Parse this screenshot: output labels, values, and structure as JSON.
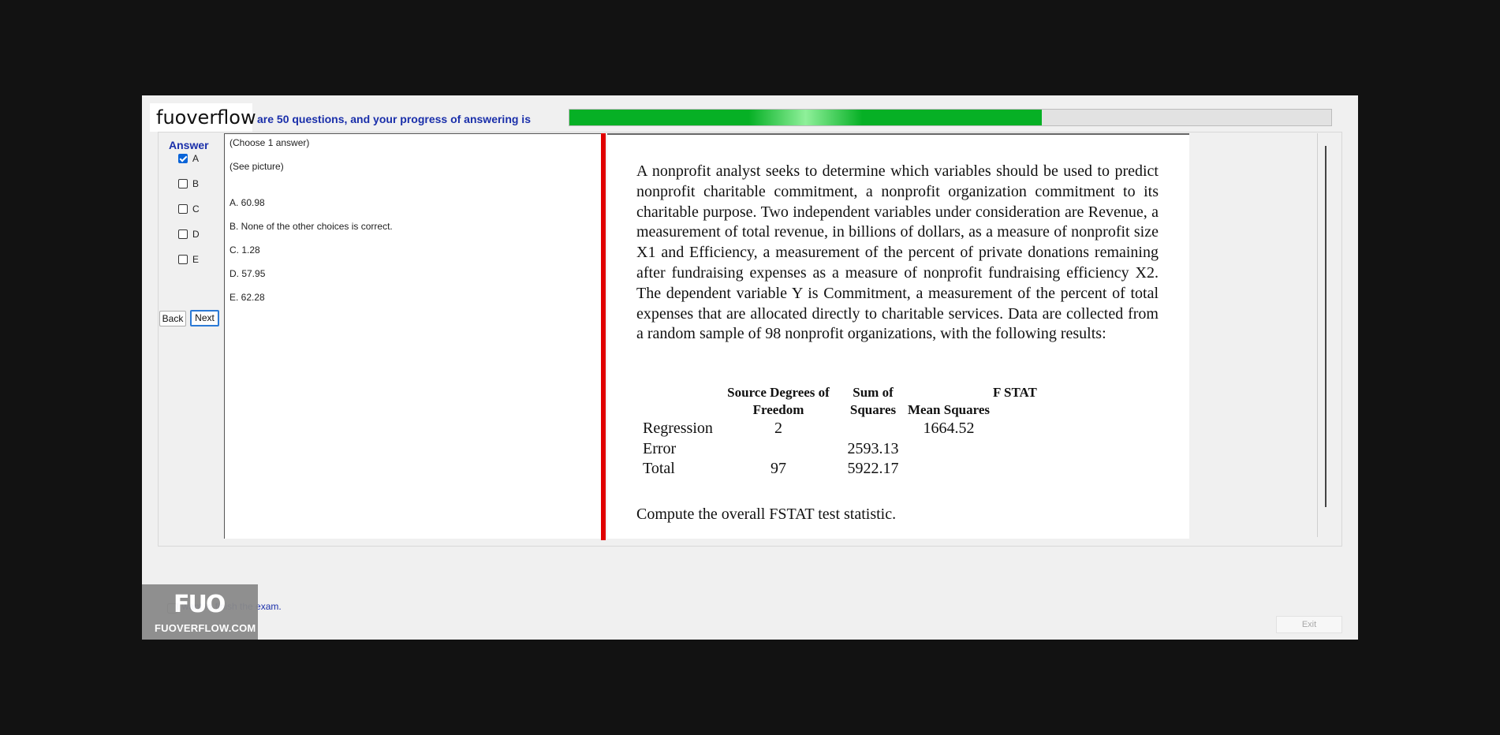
{
  "brand": "fuoverflow",
  "progress": {
    "label": "are 50 questions, and your progress of answering is",
    "value": 0.62,
    "color": "#06b025"
  },
  "answer_panel": {
    "title": "Answer",
    "options": [
      {
        "label": "A",
        "checked": true
      },
      {
        "label": "B",
        "checked": false
      },
      {
        "label": "C",
        "checked": false
      },
      {
        "label": "D",
        "checked": false
      },
      {
        "label": "E",
        "checked": false
      }
    ],
    "back_label": "Back",
    "next_label": "Next"
  },
  "question": {
    "instruction": "(Choose 1 answer)",
    "see_picture": "(See picture)",
    "choices": [
      "A.  60.98",
      "B.  None of the other choices is correct.",
      "C.  1.28",
      "D.  57.95",
      "E.  62.28"
    ]
  },
  "picture": {
    "problem_text": "A nonprofit analyst seeks to determine which variables should be used to predict nonprofit charitable commitment, a nonprofit organization commitment to its charitable purpose. Two independent variables under consideration are Revenue, a measurement of total revenue, in billions of dollars, as a measure of nonprofit size X1 and Efficiency, a measurement of the percent of private donations remaining after fundraising expenses as a measure of nonprofit fundraising efficiency X2. The dependent variable Y is Commitment, a measurement of the percent of total expenses that are allocated directly to charitable services. Data are collected from a random sample of 98 nonprofit organizations, with the following results:",
    "table": {
      "headers": [
        "",
        "Source Degrees of Freedom",
        "Sum of Squares",
        "Mean Squares",
        "F STAT"
      ],
      "rows": [
        [
          "Regression",
          "2",
          "",
          "1664.52",
          ""
        ],
        [
          "Error",
          "",
          "2593.13",
          "",
          ""
        ],
        [
          "Total",
          "97",
          "5922.17",
          "",
          ""
        ]
      ]
    },
    "compute_text": "Compute the overall FSTAT test statistic."
  },
  "watermark": {
    "logo": "FUO",
    "url": "FUOVERFLOW.COM"
  },
  "footer": {
    "finish_label": "I want to finish the exam.",
    "exit_label": "Exit"
  }
}
